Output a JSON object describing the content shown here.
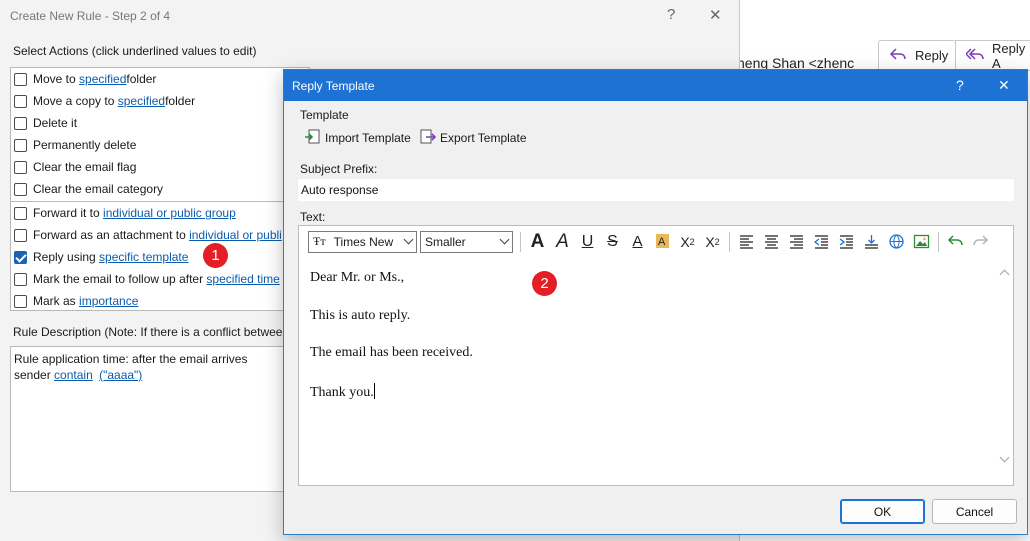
{
  "background": {
    "sender": "heng Shan <zhenc",
    "reply_label": "Reply",
    "reply_all_label": "Reply A"
  },
  "rules_dialog": {
    "title": "Create New Rule - Step 2 of 4",
    "help_glyph": "?",
    "close_glyph": "✕",
    "select_actions_label": "Select Actions (click underlined values to edit)",
    "actions": [
      {
        "pre": "Move to ",
        "link": "specified",
        "post": " folder",
        "checked": false
      },
      {
        "pre": "Move a copy to ",
        "link": "specified",
        "post": " folder",
        "checked": false
      },
      {
        "pre": "Delete it",
        "link": "",
        "post": "",
        "checked": false
      },
      {
        "pre": "Permanently delete",
        "link": "",
        "post": "",
        "checked": false
      },
      {
        "pre": "Clear the email flag",
        "link": "",
        "post": "",
        "checked": false
      },
      {
        "pre": "Clear the email category",
        "link": "",
        "post": "",
        "checked": false
      },
      {
        "pre": "Forward it to ",
        "link": "individual or public group",
        "post": "",
        "checked": false
      },
      {
        "pre": "Forward as an attachment to ",
        "link": "individual or publi",
        "post": "",
        "checked": false
      },
      {
        "pre": "Reply using ",
        "link": "specific template",
        "post": "",
        "checked": true
      },
      {
        "pre": "Mark the email to follow up after ",
        "link": "specified time",
        "post": "",
        "checked": false
      },
      {
        "pre": "Mark as ",
        "link": "importance",
        "post": "",
        "checked": false
      }
    ],
    "description_label": "Rule Description (Note: If there is a conflict between",
    "description_line1": "Rule application time: after the email arrives",
    "description_sender": "sender",
    "description_contain": "contain",
    "description_value": "(\"aaaa\")"
  },
  "badges": {
    "one": "1",
    "two": "2"
  },
  "reply_template": {
    "title": "Reply Template",
    "help_glyph": "?",
    "close_glyph": "✕",
    "template_group_label": "Template",
    "import_label": "Import Template",
    "export_label": "Export Template",
    "subject_prefix_label": "Subject Prefix:",
    "subject_prefix_value": "Auto response",
    "text_label": "Text:",
    "font_name": "Times New",
    "font_size": "Smaller",
    "body_lines": [
      "Dear Mr. or Ms.,",
      "This is auto reply.",
      "The email has been received.",
      "Thank you."
    ],
    "ok_label": "OK",
    "cancel_label": "Cancel",
    "colors": {
      "accent": "#1d72d4",
      "badge": "#e31e24",
      "link": "#0b5cad"
    }
  }
}
